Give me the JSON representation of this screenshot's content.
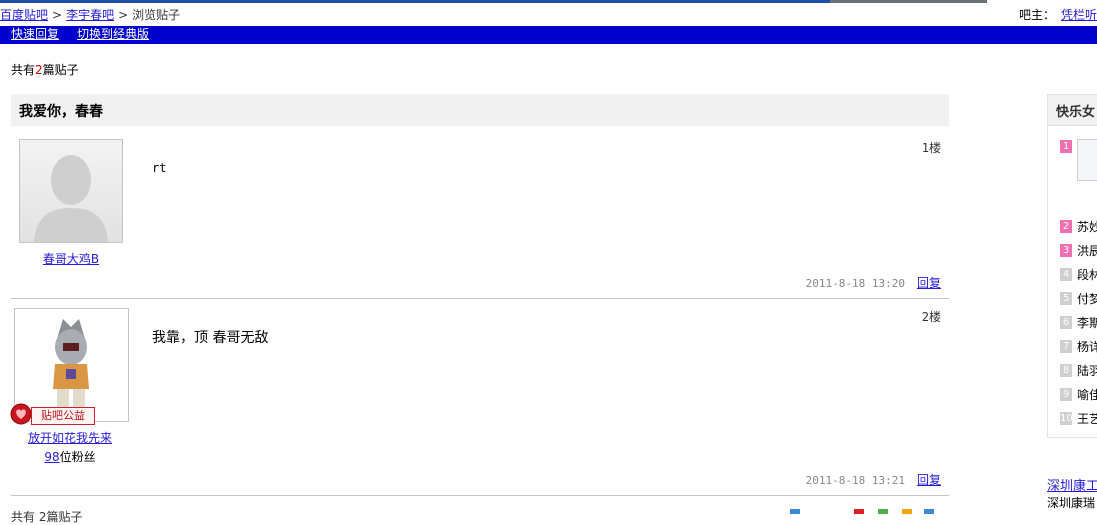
{
  "breadcrumb": {
    "home": "百度贴吧",
    "forum": "李宇春吧",
    "current": "浏览贴子"
  },
  "owner": {
    "label": "吧主：",
    "name": "凭栏听"
  },
  "nav": {
    "quick_reply": "快速回复",
    "switch_classic": "切换到经典版"
  },
  "summary": {
    "prefix": "共有",
    "count": "2",
    "suffix": "篇贴子"
  },
  "thread": {
    "title": "我爱你，春春",
    "posts": [
      {
        "floor": "1楼",
        "author": "春哥大鸡B",
        "content": "rt",
        "time": "2011-8-18 13:20",
        "reply": "回复"
      },
      {
        "floor": "2楼",
        "author": "放开如花我先来",
        "fans_count": "98",
        "fans_label": "位粉丝",
        "badge": "贴吧公益",
        "content": "我靠，顶 春哥无敌",
        "time": "2011-8-18 13:21",
        "reply": "回复"
      }
    ]
  },
  "sidebar": {
    "title": "快乐女",
    "items": [
      {
        "rank": "1",
        "name": ""
      },
      {
        "rank": "2",
        "name": "苏妙"
      },
      {
        "rank": "3",
        "name": "洪辰"
      },
      {
        "rank": "4",
        "name": "段林"
      },
      {
        "rank": "5",
        "name": "付梦"
      },
      {
        "rank": "6",
        "name": "李斯"
      },
      {
        "rank": "7",
        "name": "杨详"
      },
      {
        "rank": "8",
        "name": "陆羽"
      },
      {
        "rank": "9",
        "name": "喻佳"
      },
      {
        "rank": "10",
        "name": "王艺"
      }
    ]
  },
  "ad": {
    "link": "深圳康工",
    "sub": "深圳康瑞"
  },
  "footer": {
    "cut_text": "共有 2篇贴子"
  },
  "colors": {
    "nav_blue": "#0000cc",
    "link": "#261cdc",
    "rank_hot": "#f06fb0",
    "rank_cold": "#cfcfcf",
    "count_red": "#d40000"
  }
}
